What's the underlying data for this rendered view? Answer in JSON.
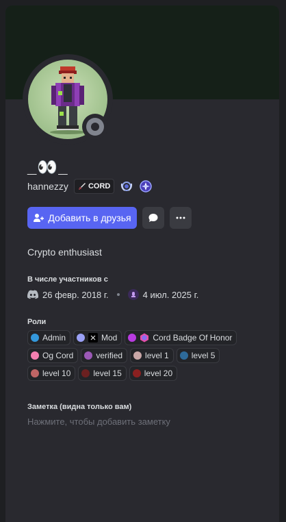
{
  "profile": {
    "display_name": "_👀_",
    "username": "hannezzy",
    "guild_tag": "CORD",
    "bio": "Crypto enthusiast"
  },
  "actions": {
    "add_friend_label": "Добавить в друзья"
  },
  "member_since": {
    "title": "В числе участников с",
    "discord_date": "26 февр. 2018 г.",
    "server_date": "4 июл. 2025 г."
  },
  "roles": {
    "title": "Роли",
    "items": [
      {
        "name": "Admin",
        "color": "#3498db"
      },
      {
        "name": "Mod",
        "color": "#9aa0f5"
      },
      {
        "name": "Cord Badge Of Honor",
        "color": "#b83be0"
      },
      {
        "name": "Og Cord",
        "color": "#f47fb0"
      },
      {
        "name": "verified",
        "color": "#9b59b6"
      },
      {
        "name": "level 1",
        "color": "#c9a7a7"
      },
      {
        "name": "level 5",
        "color": "#2e6a99"
      },
      {
        "name": "level 10",
        "color": "#c06565"
      },
      {
        "name": "level 15",
        "color": "#6b2020"
      },
      {
        "name": "level 20",
        "color": "#8a2020"
      }
    ]
  },
  "note": {
    "title": "Заметка (видна только вам)",
    "placeholder": "Нажмите, чтобы добавить заметку"
  },
  "colors": {
    "accent": "#5865f2",
    "banner": "#152018",
    "panel": "#29292f"
  }
}
